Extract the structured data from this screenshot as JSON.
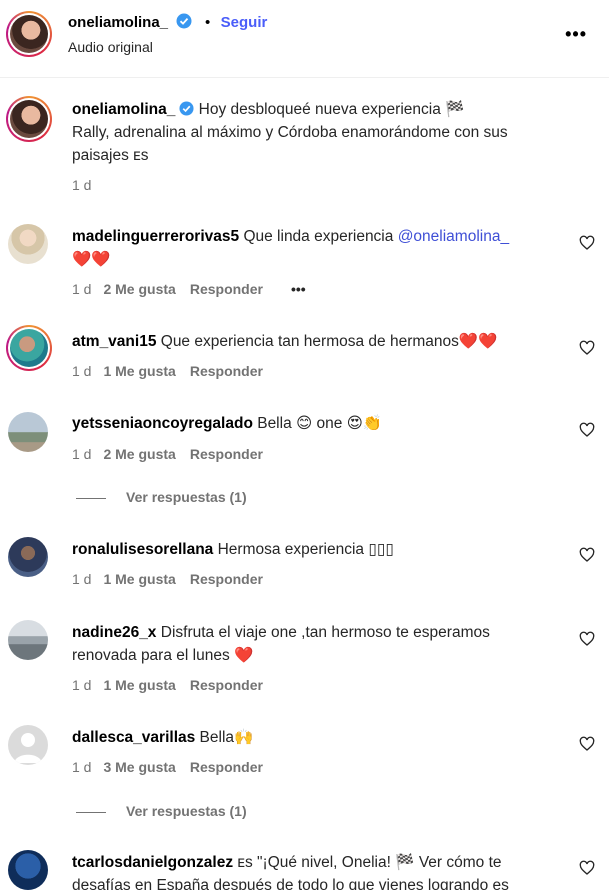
{
  "header": {
    "username": "oneliamolina_",
    "separator": "•",
    "follow_label": "Seguir",
    "subtitle": "Audio original",
    "more": "•••"
  },
  "caption": {
    "username": "oneliamolina_",
    "text_line1": " Hoy desbloqueé nueva experiencia 🏁",
    "text_line2": "Rally, adrenalina al máximo y Córdoba enamorándome con sus",
    "text_line3": "paisajes ᴇs",
    "time": "1 d"
  },
  "comments": [
    {
      "username": "madelinguerrerorivas5",
      "text": " Que linda experiencia ",
      "mention": "@oneliamolina_",
      "text2": "❤️❤️",
      "time": "1 d",
      "likes": "2 Me gusta",
      "reply": "Responder",
      "options": "•••"
    },
    {
      "username": "atm_vani15",
      "text": " Que experiencia tan hermosa de hermanos❤️❤️",
      "time": "1 d",
      "likes": "1 Me gusta",
      "reply": "Responder"
    },
    {
      "username": "yetsseniaoncoyregalado",
      "text": " Bella 😊 one 😍👏",
      "time": "1 d",
      "likes": "2 Me gusta",
      "reply": "Responder",
      "view_replies": "Ver respuestas (1)"
    },
    {
      "username": "ronalulisesorellana",
      "text": " Hermosa experiencia ▯▯▯",
      "time": "1 d",
      "likes": "1 Me gusta",
      "reply": "Responder"
    },
    {
      "username": "nadine26_x",
      "text": " Disfruta el viaje one ,tan hermoso te esperamos",
      "text2": "renovada para el lunes ❤️",
      "time": "1 d",
      "likes": "1 Me gusta",
      "reply": "Responder"
    },
    {
      "username": "dallesca_varillas",
      "text": " Bella🙌",
      "time": "1 d",
      "likes": "3 Me gusta",
      "reply": "Responder",
      "view_replies": "Ver respuestas (1)"
    },
    {
      "username": "tcarlosdanielgonzalez",
      "text": " ᴇs \"¡Qué nivel, Onelia! 🏁 Ver cómo te",
      "text2": "desafías en España después de todo lo que vienes logrando es"
    }
  ],
  "colors": {
    "accent": "#4a5df9",
    "mention": "#3f4fd6",
    "meta": "#737373",
    "heart_red": "#e0245e"
  }
}
